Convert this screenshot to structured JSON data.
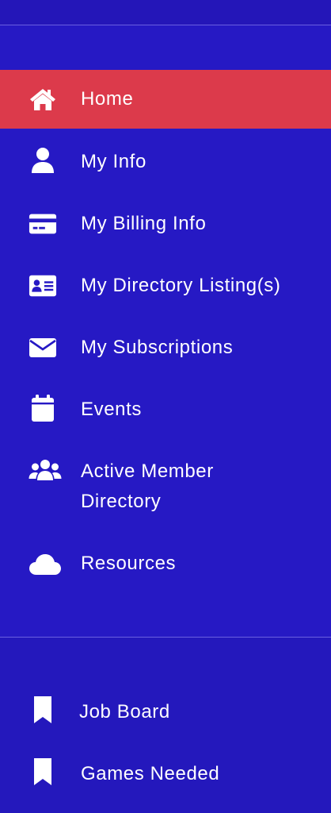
{
  "nav": {
    "items": [
      {
        "label": "Home",
        "icon": "home-icon",
        "active": true
      },
      {
        "label": "My Info",
        "icon": "user-icon"
      },
      {
        "label": "My Billing Info",
        "icon": "credit-card-icon"
      },
      {
        "label": "My Directory Listing(s)",
        "icon": "id-card-icon"
      },
      {
        "label": "My Subscriptions",
        "icon": "envelope-icon"
      },
      {
        "label": "Events",
        "icon": "calendar-icon"
      },
      {
        "label_line1": "Active Member",
        "label_line2": "Directory",
        "icon": "users-icon"
      },
      {
        "label": "Resources",
        "icon": "cloud-icon"
      }
    ]
  },
  "secondary_nav": {
    "items": [
      {
        "label": "Job Board",
        "icon": "bookmark-icon"
      },
      {
        "label": "Games Needed",
        "icon": "bookmark-icon"
      }
    ]
  },
  "colors": {
    "background": "#2619c4",
    "active": "#dc3a4b",
    "text": "#ffffff"
  }
}
